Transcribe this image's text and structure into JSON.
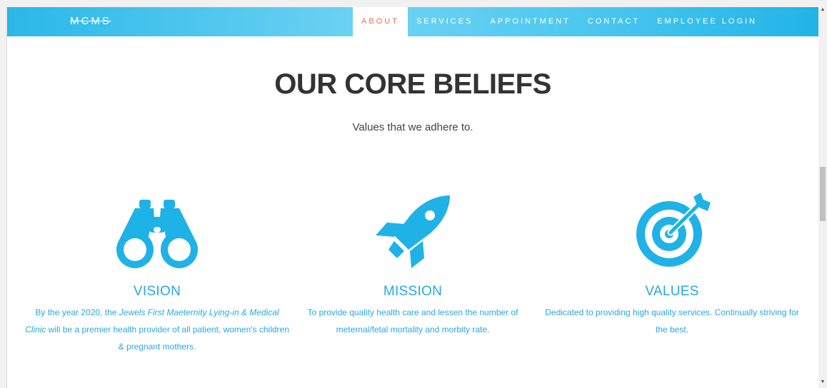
{
  "navbar": {
    "brand": "MCMS",
    "links": [
      {
        "label": "ABOUT",
        "active": true
      },
      {
        "label": "SERVICES",
        "active": false
      },
      {
        "label": "APPOINTMENT",
        "active": false
      },
      {
        "label": "CONTACT",
        "active": false
      },
      {
        "label": "EMPLOYEE LOGIN",
        "active": false
      }
    ]
  },
  "hero": {
    "title": "OUR CORE BELIEFS",
    "subtitle": "Values that we adhere to."
  },
  "columns": [
    {
      "icon": "binoculars-icon",
      "title": "VISION",
      "text_before": "By the year 2020, the ",
      "text_italic": "Jewels First Maeternity Lying-in & Medical Clinic",
      "text_after": " will be a premier health provider of all patient, women's children & pregnant mothers."
    },
    {
      "icon": "rocket-icon",
      "title": "MISSION",
      "text": "To provide quality health care and lessen the number of meternal/fetal mortality and morbity rate."
    },
    {
      "icon": "target-icon",
      "title": "VALUES",
      "text": "Dedicated to providing high quality services. Continually striving for the best."
    }
  ],
  "colors": {
    "accent": "#29a8de",
    "active_nav": "#ee6d4d",
    "heading": "#333333"
  }
}
